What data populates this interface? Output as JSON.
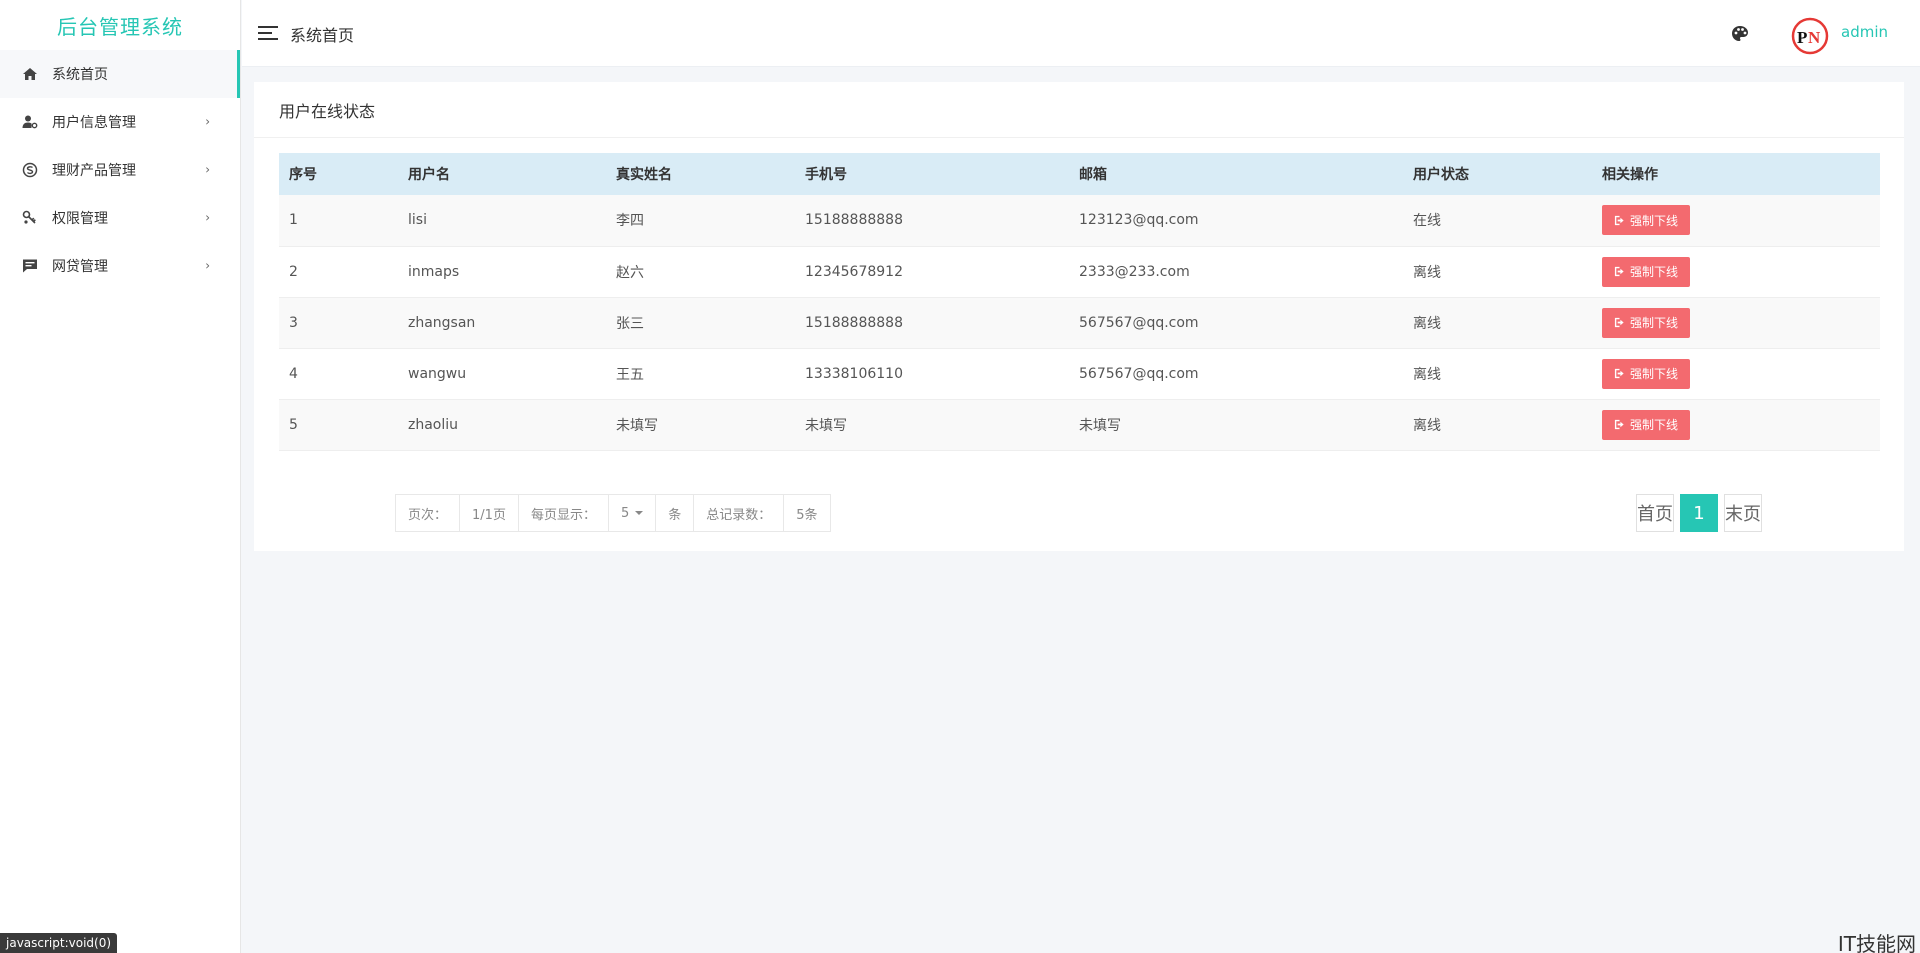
{
  "brand": {
    "title": "后台管理系统"
  },
  "sidebar": {
    "items": [
      {
        "label": "系统首页",
        "icon": "home-icon",
        "active": true,
        "has_children": false
      },
      {
        "label": "用户信息管理",
        "icon": "user-settings-icon",
        "has_children": true
      },
      {
        "label": "理财产品管理",
        "icon": "skype-icon",
        "has_children": true
      },
      {
        "label": "权限管理",
        "icon": "key-icon",
        "has_children": true
      },
      {
        "label": "网贷管理",
        "icon": "message-icon",
        "has_children": true
      }
    ],
    "chevron": "›"
  },
  "header": {
    "title": "系统首页",
    "username": "admin",
    "icons": [
      "menu-icon",
      "palette-icon",
      "avatar"
    ]
  },
  "card": {
    "title": "用户在线状态",
    "table": {
      "headers": [
        "序号",
        "用户名",
        "真实姓名",
        "手机号",
        "邮箱",
        "用户状态",
        "相关操作"
      ],
      "rows": [
        {
          "id": "1",
          "username": "lisi",
          "realname": "李四",
          "phone": "15188888888",
          "email": "123123@qq.com",
          "status": "在线",
          "action": "强制下线"
        },
        {
          "id": "2",
          "username": "inmaps",
          "realname": "赵六",
          "phone": "12345678912",
          "email": "2333@233.com",
          "status": "离线",
          "action": "强制下线"
        },
        {
          "id": "3",
          "username": "zhangsan",
          "realname": "张三",
          "phone": "15188888888",
          "email": "567567@qq.com",
          "status": "离线",
          "action": "强制下线"
        },
        {
          "id": "4",
          "username": "wangwu",
          "realname": "王五",
          "phone": "13338106110",
          "email": "567567@qq.com",
          "status": "离线",
          "action": "强制下线"
        },
        {
          "id": "5",
          "username": "zhaoliu",
          "realname": "未填写",
          "phone": "未填写",
          "email": "未填写",
          "status": "离线",
          "action": "强制下线"
        }
      ]
    },
    "page_info": {
      "page_label": "页次：",
      "page_value": "1/1页",
      "per_page_label": "每页显示：",
      "per_page_value": "5",
      "per_page_unit": "条",
      "total_label": "总记录数：",
      "total_value": "5条"
    },
    "pager": {
      "first": "首页",
      "current": "1",
      "last": "末页"
    }
  },
  "status_bar": {
    "text": "javascript:void(0)"
  },
  "watermark": {
    "text": "IT技能网"
  },
  "colors": {
    "accent": "#26c6b4",
    "danger_button": "#f36a6f",
    "table_header_bg": "#d9ecf6",
    "page_bg": "#f4f6f9"
  }
}
